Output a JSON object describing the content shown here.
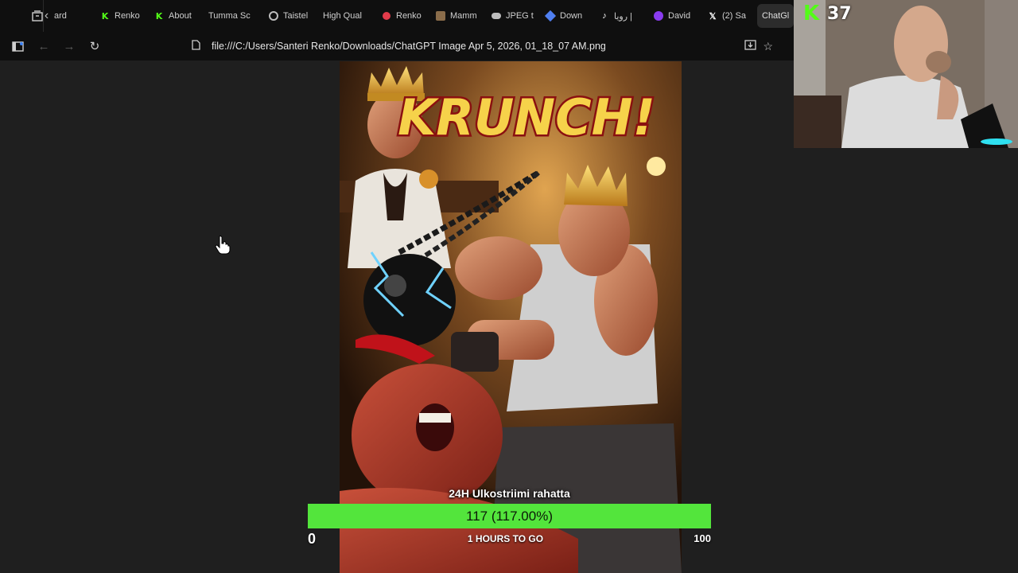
{
  "browser": {
    "tabs": [
      {
        "label": "ard",
        "icon": "generic"
      },
      {
        "label": "Renko",
        "icon": "kick-icon"
      },
      {
        "label": "About",
        "icon": "kick-icon"
      },
      {
        "label": "Tumma Sc",
        "icon": "none"
      },
      {
        "label": "Taistel",
        "icon": "circle-icon"
      },
      {
        "label": "High Qual",
        "icon": "none"
      },
      {
        "label": "Renko",
        "icon": "red-icon"
      },
      {
        "label": "Mamm",
        "icon": "image-icon"
      },
      {
        "label": "JPEG t",
        "icon": "cloud-icon"
      },
      {
        "label": "Down",
        "icon": "blue-icon"
      },
      {
        "label": "رويا |",
        "icon": "tiktok-icon"
      },
      {
        "label": "David",
        "icon": "purple-icon"
      },
      {
        "label": "(2) Sa",
        "icon": "x-icon"
      },
      {
        "label": "ChatGl",
        "icon": "none",
        "active": true
      }
    ],
    "address": {
      "url": "file:///C:/Users/Santeri Renko/Downloads/ChatGPT Image Apr 5, 2026, 01_18_07 AM.png"
    }
  },
  "image": {
    "headline": "KRUNCH!"
  },
  "stream": {
    "kick_viewers": "37"
  },
  "goal": {
    "title": "24H Ulkostriimi rahatta",
    "value_text": "117 (117.00%)",
    "progress_fraction": 1.0,
    "min_label": "0",
    "remaining_text": "1 HOURS TO GO",
    "max_label": "100",
    "bar_color": "#53e53c"
  }
}
